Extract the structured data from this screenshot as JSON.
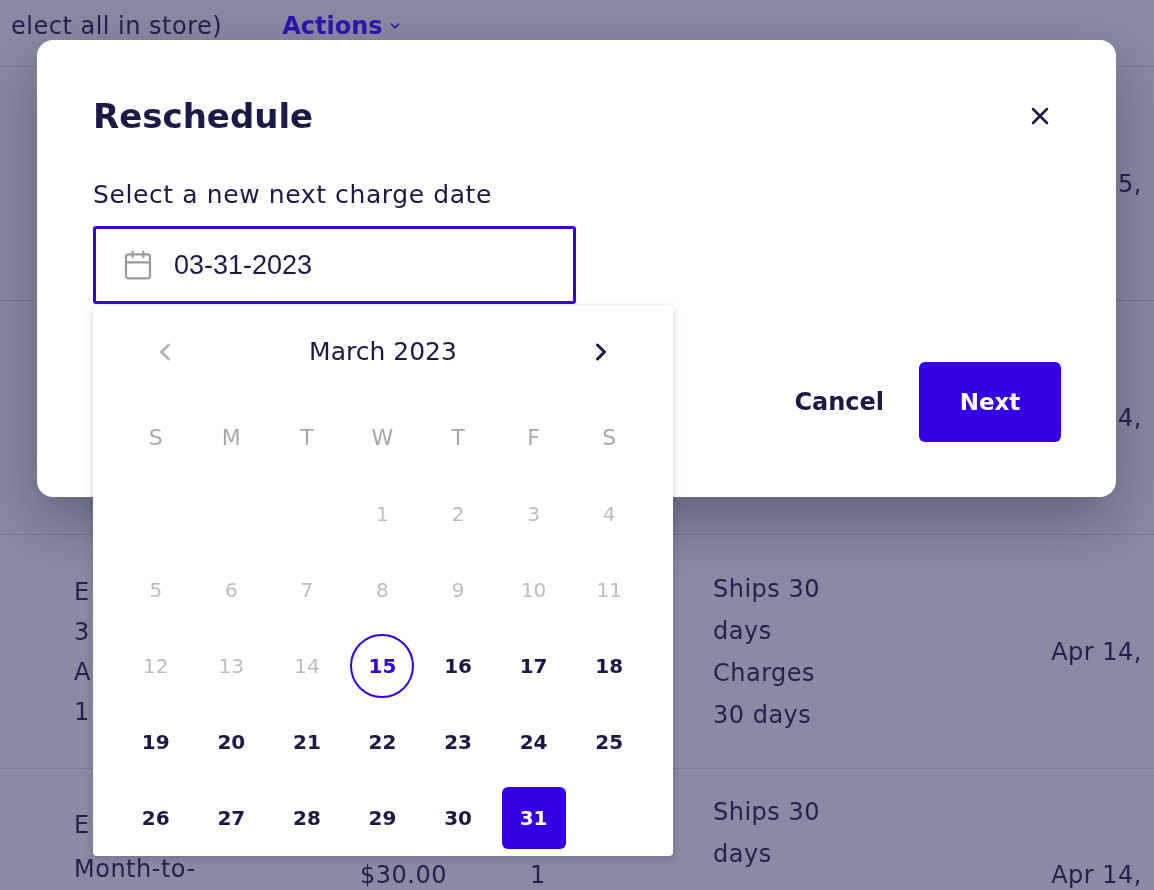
{
  "background": {
    "toolbar": {
      "select_all": "elect all in store)",
      "actions_menu": "Actions"
    },
    "rows": [
      {
        "column_5": "5,"
      },
      {
        "column_5": "4,"
      },
      {
        "column_1": [
          "E",
          "3",
          "A",
          "1"
        ],
        "column_4": [
          "Ships 30 days",
          "Charges 30 days"
        ],
        "column_5": "Apr 14,"
      },
      {
        "column_1": [
          "E",
          "Month-to-"
        ],
        "column_2": "$30.00",
        "column_3": "1",
        "column_4": [
          "Ships 30 days"
        ],
        "column_5": "Apr 14,"
      }
    ]
  },
  "dialog": {
    "title": "Reschedule",
    "field_label": "Select a new next charge date",
    "date_field": {
      "value": "03-31-2023",
      "focused": true
    },
    "buttons": [
      {
        "label": "Cancel",
        "kind": "text"
      },
      {
        "label": "Next",
        "kind": "primary"
      }
    ]
  },
  "calendar": {
    "month": "March 2023",
    "prev": {
      "disabled": true
    },
    "next": {
      "disabled": false
    },
    "weekdays": [
      "S",
      "M",
      "T",
      "W",
      "T",
      "F",
      "S"
    ],
    "weeks": [
      [
        {
          "day": "1",
          "disabled": true,
          "today": false,
          "selected": false
        },
        {
          "day": "2",
          "disabled": true,
          "today": false,
          "selected": false
        },
        {
          "day": "3",
          "disabled": true,
          "today": false,
          "selected": false
        },
        {
          "day": "4",
          "disabled": true,
          "today": false,
          "selected": false
        }
      ],
      [
        {
          "day": "5",
          "disabled": true,
          "today": false,
          "selected": false
        },
        {
          "day": "6",
          "disabled": true,
          "today": false,
          "selected": false
        },
        {
          "day": "7",
          "disabled": true,
          "today": false,
          "selected": false
        },
        {
          "day": "8",
          "disabled": true,
          "today": false,
          "selected": false
        },
        {
          "day": "9",
          "disabled": true,
          "today": false,
          "selected": false
        },
        {
          "day": "10",
          "disabled": true,
          "today": false,
          "selected": false
        },
        {
          "day": "11",
          "disabled": true,
          "today": false,
          "selected": false
        }
      ],
      [
        {
          "day": "12",
          "disabled": true,
          "today": false,
          "selected": false
        },
        {
          "day": "13",
          "disabled": true,
          "today": false,
          "selected": false
        },
        {
          "day": "14",
          "disabled": true,
          "today": false,
          "selected": false
        },
        {
          "day": "15",
          "disabled": false,
          "today": true,
          "selected": false
        },
        {
          "day": "16",
          "disabled": false,
          "today": false,
          "selected": false
        },
        {
          "day": "17",
          "disabled": false,
          "today": false,
          "selected": false
        },
        {
          "day": "18",
          "disabled": false,
          "today": false,
          "selected": false
        }
      ],
      [
        {
          "day": "19",
          "disabled": false,
          "today": false,
          "selected": false
        },
        {
          "day": "20",
          "disabled": false,
          "today": false,
          "selected": false
        },
        {
          "day": "21",
          "disabled": false,
          "today": false,
          "selected": false
        },
        {
          "day": "22",
          "disabled": false,
          "today": false,
          "selected": false
        },
        {
          "day": "23",
          "disabled": false,
          "today": false,
          "selected": false
        },
        {
          "day": "24",
          "disabled": false,
          "today": false,
          "selected": false
        },
        {
          "day": "25",
          "disabled": false,
          "today": false,
          "selected": false
        }
      ],
      [
        {
          "day": "26",
          "disabled": false,
          "today": false,
          "selected": false
        },
        {
          "day": "27",
          "disabled": false,
          "today": false,
          "selected": false
        },
        {
          "day": "28",
          "disabled": false,
          "today": false,
          "selected": false
        },
        {
          "day": "29",
          "disabled": false,
          "today": false,
          "selected": false
        },
        {
          "day": "30",
          "disabled": false,
          "today": false,
          "selected": false
        },
        {
          "day": "31",
          "disabled": false,
          "today": false,
          "selected": true
        }
      ]
    ]
  }
}
